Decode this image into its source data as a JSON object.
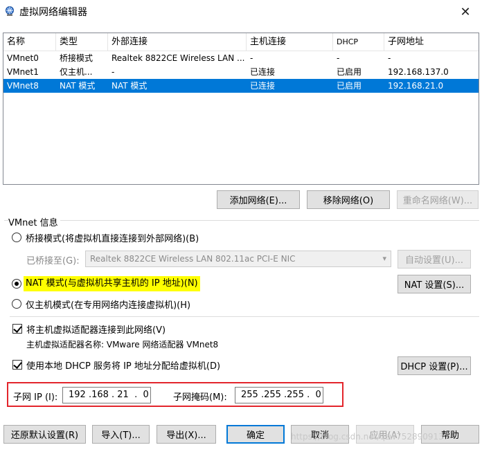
{
  "window": {
    "title": "虚拟网络编辑器",
    "icon": "network-editor-icon",
    "close_glyph": "✕"
  },
  "table": {
    "columns": [
      "名称",
      "类型",
      "外部连接",
      "主机连接",
      "DHCP",
      "子网地址"
    ],
    "rows": [
      {
        "name": "VMnet0",
        "type": "桥接模式",
        "external": "Realtek 8822CE Wireless LAN ...",
        "host": "-",
        "dhcp": "-",
        "subnet": "-"
      },
      {
        "name": "VMnet1",
        "type": "仅主机...",
        "external": "-",
        "host": "已连接",
        "dhcp": "已启用",
        "subnet": "192.168.137.0"
      },
      {
        "name": "VMnet8",
        "type": "NAT 模式",
        "external": "NAT 模式",
        "host": "已连接",
        "dhcp": "已启用",
        "subnet": "192.168.21.0"
      }
    ],
    "selected_row": "VMnet8"
  },
  "network_buttons": {
    "add": "添加网络(E)...",
    "remove": "移除网络(O)",
    "rename": "重命名网络(W)..."
  },
  "vmnet_info": {
    "label": "VMnet 信息",
    "bridged_label": "桥接模式(将虚拟机直接连接到外部网络)(B)",
    "bridged_to_label": "已桥接至(G):",
    "bridged_to_value": "Realtek 8822CE Wireless LAN 802.11ac PCI-E NIC",
    "auto_settings": "自动设置(U)...",
    "nat_label": "NAT 模式(与虚拟机共享主机的 IP 地址)(N)",
    "nat_settings": "NAT 设置(S)...",
    "hostonly_label": "仅主机模式(在专用网络内连接虚拟机)(H)",
    "connect_adapter_label": "将主机虚拟适配器连接到此网络(V)",
    "adapter_name_label": "主机虚拟适配器名称: VMware 网络适配器 VMnet8",
    "dhcp_label": "使用本地 DHCP 服务将 IP 地址分配给虚拟机(D)",
    "dhcp_settings": "DHCP 设置(P)...",
    "selected_mode": "nat"
  },
  "subnet": {
    "ip_label": "子网 IP (I):",
    "ip_value": "192 .168 . 21  .  0",
    "mask_label": "子网掩码(M):",
    "mask_value": "255 .255 .255 .  0"
  },
  "footer": {
    "restore": "还原默认设置(R)",
    "import": "导入(T)...",
    "export": "导出(X)...",
    "ok": "确定",
    "cancel": "取消",
    "apply": "应用(A)",
    "help": "帮助"
  },
  "watermark": "https://blog.csdn.net/qzw752890913",
  "colors": {
    "selection": "#0078d7",
    "highlight": "#ffff00",
    "red_box": "#e3242b"
  }
}
